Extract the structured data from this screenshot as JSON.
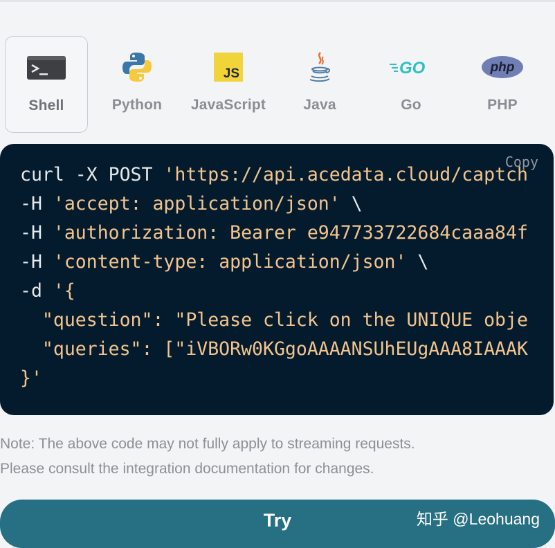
{
  "tabs": [
    {
      "label": "Shell",
      "icon": "terminal-icon",
      "active": true
    },
    {
      "label": "Python",
      "icon": "python-logo-icon",
      "active": false
    },
    {
      "label": "JavaScript",
      "icon": "javascript-logo-icon",
      "active": false
    },
    {
      "label": "Java",
      "icon": "java-logo-icon",
      "active": false
    },
    {
      "label": "Go",
      "icon": "go-logo-icon",
      "active": false,
      "logo_text": "GO"
    },
    {
      "label": "PHP",
      "icon": "php-logo-icon",
      "active": false,
      "logo_text": "php"
    }
  ],
  "code_block": {
    "copy_label": "Copy",
    "lines": [
      {
        "cmd": "curl -X POST ",
        "str": "'https://api.acedata.cloud/captch"
      },
      {
        "cmd": "-H ",
        "str": "'accept: application/json'",
        "tail": " \\"
      },
      {
        "cmd": "-H ",
        "str": "'authorization: Bearer e947733722684caaa84f"
      },
      {
        "cmd": "-H ",
        "str": "'content-type: application/json'",
        "tail": " \\"
      },
      {
        "cmd": "-d ",
        "str": "'{"
      },
      {
        "str": "  \"question\": \"Please click on the UNIQUE obje"
      },
      {
        "str": "  \"queries\": [\"iVBORw0KGgoAAAANSUhEUgAAA8IAAAK"
      },
      {
        "str": "}'"
      }
    ]
  },
  "note": {
    "line1": "Note: The above code may not fully apply to streaming requests.",
    "line2": "Please consult the integration documentation for changes."
  },
  "try_button": {
    "label": "Try"
  },
  "watermark": "知乎 @Leohuang",
  "colors": {
    "page_bg": "#f3f4f6",
    "code_bg": "#041b2d",
    "code_string": "#f3c48e",
    "code_text": "#e6e8ea",
    "button_bg": "#276f83",
    "label_gray": "#8a8d93"
  }
}
